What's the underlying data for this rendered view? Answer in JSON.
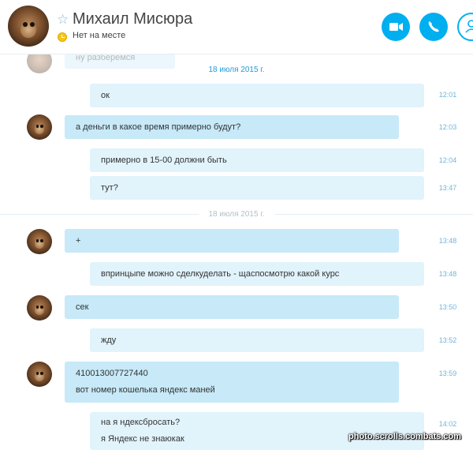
{
  "contact": {
    "name": "Михаил Мисюра",
    "status": "Нет на месте"
  },
  "header_icons": {
    "favorite": "star-outline-icon",
    "status": "away-clock-icon",
    "video": "video-call-icon",
    "call": "phone-call-icon",
    "profile": "profile-icon"
  },
  "colors": {
    "accent": "#00aff0",
    "bubble_out": "#e1f3fb",
    "bubble_in": "#c7e9f8",
    "time": "#6fb6d8",
    "away": "#f5c518"
  },
  "chat": {
    "faded_text": "ну разберемся",
    "date_header": "18 июля 2015 г.",
    "date_separator": "18 июля 2015 г.",
    "messages": [
      {
        "text": "ок",
        "time": "12:01"
      },
      {
        "text": "а деньги в какое время примерно будут?",
        "time": "12:03"
      },
      {
        "text": "примерно в 15-00 должни быть",
        "time": "12:04"
      },
      {
        "text": "тут?",
        "time": "13:47"
      },
      {
        "text": "+",
        "time": "13:48"
      },
      {
        "text": "впринцыпе можно сделкуделать - щаспосмотрю какой курс",
        "time": "13:48"
      },
      {
        "text": "сек",
        "time": "13:50"
      },
      {
        "text": "жду",
        "time": "13:52"
      },
      {
        "lines": [
          "410013007727440",
          "вот номер кошелька яндекс маней"
        ],
        "time": "13:59"
      },
      {
        "lines": [
          "на я ндексбросать?",
          "я Яндекс не  знаюкак"
        ],
        "time": "14:02"
      }
    ]
  },
  "watermark": "photo.scrolls.combats.com"
}
